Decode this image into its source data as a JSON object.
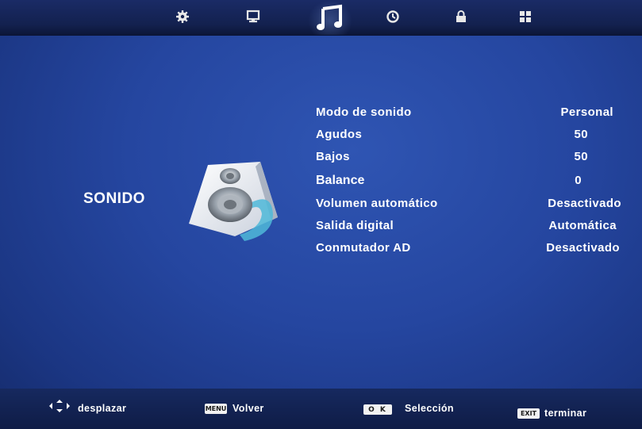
{
  "menu_tabs": [
    {
      "icon": "gear-icon"
    },
    {
      "icon": "monitor-icon"
    },
    {
      "icon": "music-note-icon",
      "active": true
    },
    {
      "icon": "clock-icon"
    },
    {
      "icon": "lock-icon"
    },
    {
      "icon": "grid-icon"
    }
  ],
  "section": {
    "title": "SONIDO",
    "icon": "speaker-icon"
  },
  "settings": [
    {
      "label": "Modo de sonido",
      "value": "Personal"
    },
    {
      "label": "Agudos",
      "value": "50"
    },
    {
      "label": "Bajos",
      "value": "50"
    },
    {
      "label": "Balance",
      "value": "0",
      "selected": true
    },
    {
      "label": "Volumen automático",
      "value": "Desactivado"
    },
    {
      "label": "Salida digital",
      "value": "Automática"
    },
    {
      "label": "Conmutador AD",
      "value": "Desactivado"
    }
  ],
  "footer": {
    "navigate_label": "desplazar",
    "menu_key": "MENU",
    "back_label": "Volver",
    "ok_key": "O K",
    "select_label": "Selección",
    "exit_key": "EXIT",
    "exit_label": "terminar"
  },
  "colors": {
    "background": "#2546a0",
    "text": "#ffffff",
    "topbar": "#13214f"
  }
}
